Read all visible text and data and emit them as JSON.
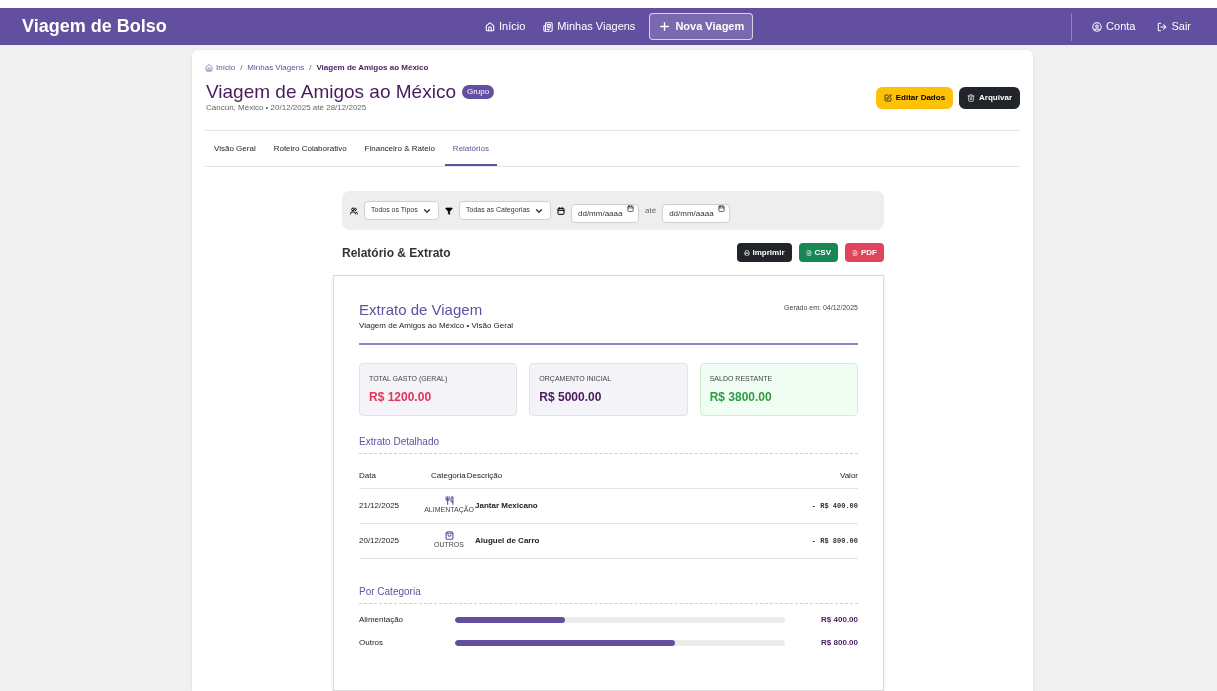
{
  "navbar": {
    "brand": "Viagem de Bolso",
    "links": [
      {
        "label": "Início",
        "kind": "link"
      },
      {
        "label": "Minhas Viagens",
        "kind": "link"
      },
      {
        "label": "Nova Viagem",
        "kind": "outlined"
      }
    ],
    "account": [
      {
        "label": "Conta"
      },
      {
        "label": "Sair"
      }
    ]
  },
  "breadcrumb": {
    "separator": "/",
    "items": [
      {
        "label": "Início",
        "current": false
      },
      {
        "label": "Minhas Viagens",
        "current": false
      },
      {
        "label": "Viagem de Amigos ao México",
        "current": true
      }
    ]
  },
  "trip": {
    "title": "Viagem de Amigos ao México",
    "badge": "Grupo",
    "subtitle": "Cancún, México • 20/12/2025 até 28/12/2025"
  },
  "actions": [
    {
      "label": "Editar Dados",
      "kind": "warning"
    },
    {
      "label": "Arquivar",
      "kind": "dark"
    }
  ],
  "tabs": [
    {
      "label": "Visão Geral",
      "selected": false
    },
    {
      "label": "Roteiro Colaborativo",
      "selected": false
    },
    {
      "label": "Financeiro & Rateio",
      "selected": false
    },
    {
      "label": "Relatórios",
      "selected": true
    }
  ],
  "filters": {
    "type_select": "Todos os Tipos",
    "category_select": "Todas as Categorias",
    "date_from": {
      "placeholder": "dd/mm/aaaa"
    },
    "between": "até",
    "date_to": {
      "placeholder": "dd/mm/aaaa"
    }
  },
  "report": {
    "title": "Relatório & Extrato",
    "exports": [
      {
        "label": "Imprimir",
        "kind": "print"
      },
      {
        "label": "CSV",
        "kind": "csv"
      },
      {
        "label": "PDF",
        "kind": "pdf"
      }
    ]
  },
  "statement": {
    "title": "Extrato de Viagem",
    "subtitle": "Viagem de Amigos ao México • Visão Geral",
    "generated": "Gerado em: 04/12/2025",
    "summary": [
      {
        "label": "TOTAL GASTO (GERAL)",
        "value": "R$ 1200.00",
        "kind": "expense"
      },
      {
        "label": "ORÇAMENTO INICIAL",
        "value": "R$ 5000.00",
        "kind": "neutral"
      },
      {
        "label": "SALDO RESTANTE",
        "value": "R$ 3800.00",
        "kind": "positive"
      }
    ],
    "details_title": "Extrato Detalhado",
    "columns": [
      "Data",
      "Categoria",
      "Descrição",
      "Valor"
    ],
    "rows": [
      {
        "date": "21/12/2025",
        "category": "ALIMENTAÇÃO",
        "kind": "food",
        "description": "Jantar Mexicano",
        "value": "- R$ 400.00"
      },
      {
        "date": "20/12/2025",
        "category": "OUTROS",
        "kind": "other",
        "description": "Aluguel de Carro",
        "value": "- R$ 800.00"
      }
    ],
    "by_category_title": "Por Categoria",
    "categories": [
      {
        "name": "Alimentação",
        "level": 0.333,
        "amount": "R$ 400.00"
      },
      {
        "name": "Outros",
        "level": 0.667,
        "amount": "R$ 800.00"
      }
    ]
  }
}
